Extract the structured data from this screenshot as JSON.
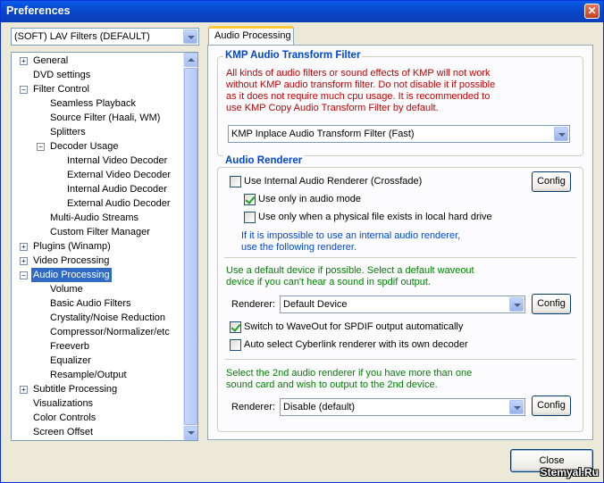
{
  "window": {
    "title": "Preferences"
  },
  "preset": {
    "value": "(SOFT) LAV Filters (DEFAULT)"
  },
  "tree": {
    "items": [
      {
        "label": "General",
        "expander": "+"
      },
      {
        "label": "DVD settings"
      },
      {
        "label": "Filter Control",
        "expander": "−"
      },
      {
        "label": "Seamless Playback"
      },
      {
        "label": "Source Filter (Haali, WM)"
      },
      {
        "label": "Splitters"
      },
      {
        "label": "Decoder Usage",
        "expander": "−"
      },
      {
        "label": "Internal Video Decoder"
      },
      {
        "label": "External Video Decoder"
      },
      {
        "label": "Internal Audio Decoder"
      },
      {
        "label": "External Audio Decoder"
      },
      {
        "label": "Multi-Audio Streams"
      },
      {
        "label": "Custom Filter Manager"
      },
      {
        "label": "Plugins (Winamp)",
        "expander": "+"
      },
      {
        "label": "Video Processing",
        "expander": "+"
      },
      {
        "label": "Audio Processing",
        "expander": "−"
      },
      {
        "label": "Volume"
      },
      {
        "label": "Basic Audio Filters"
      },
      {
        "label": "Crystality/Noise Reduction"
      },
      {
        "label": "Compressor/Normalizer/etc"
      },
      {
        "label": "Freeverb"
      },
      {
        "label": "Equalizer"
      },
      {
        "label": "Resample/Output"
      },
      {
        "label": "Subtitle Processing",
        "expander": "+"
      },
      {
        "label": "Visualizations"
      },
      {
        "label": "Color Controls"
      },
      {
        "label": "Screen Offset"
      }
    ]
  },
  "tab": {
    "label": "Audio Processing"
  },
  "transform": {
    "title": "KMP Audio Transform Filter",
    "note_lines": [
      "All kinds of audio filters or sound effects of KMP will not work",
      "without KMP audio transform filter. Do not disable it if possible",
      "as it does not require much cpu usage. It is recommended to",
      "use KMP Copy Audio Transform Filter by default."
    ],
    "filter": "KMP Inplace Audio Transform Filter (Fast)"
  },
  "renderer": {
    "title": "Audio Renderer",
    "use_internal": "Use Internal Audio Renderer (Crossfade)",
    "config": "Config",
    "audio_mode_only": "Use only in audio mode",
    "local_file_only": "Use only when a physical file exists in local hard drive",
    "fallback_lines": [
      "If it is impossible to use an internal audio renderer,",
      "use the following renderer."
    ],
    "default_note_lines": [
      "Use a default device if possible. Select a default waveout",
      "device if you can't hear a sound in spdif output."
    ],
    "renderer_label": "Renderer:",
    "device": "Default Device",
    "switch_waveout": "Switch to WaveOut for SPDIF output automatically",
    "auto_cyberlink": "Auto select Cyberlink renderer with its own decoder",
    "second_note_lines": [
      "Select the 2nd audio renderer if you have more than one",
      "sound card and wish to output to the 2nd device."
    ],
    "second_device": "Disable (default)"
  },
  "footer": {
    "close": "Close",
    "watermark": "Stemyal.Ru"
  }
}
